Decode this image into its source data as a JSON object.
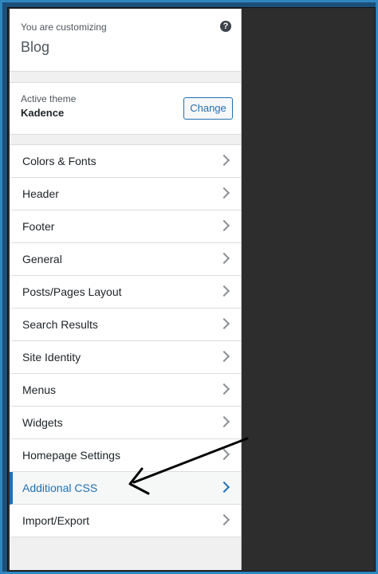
{
  "header": {
    "customizing_label": "You are customizing",
    "title": "Blog",
    "help_icon": "?"
  },
  "theme": {
    "label": "Active theme",
    "name": "Kadence",
    "change_label": "Change"
  },
  "menu": {
    "items": [
      {
        "label": "Colors & Fonts"
      },
      {
        "label": "Header"
      },
      {
        "label": "Footer"
      },
      {
        "label": "General"
      },
      {
        "label": "Posts/Pages Layout"
      },
      {
        "label": "Search Results"
      },
      {
        "label": "Site Identity"
      },
      {
        "label": "Menus"
      },
      {
        "label": "Widgets"
      },
      {
        "label": "Homepage Settings"
      },
      {
        "label": "Additional CSS",
        "active": true
      },
      {
        "label": "Import/Export"
      }
    ]
  },
  "colors": {
    "accent": "#2271b1",
    "frame": "#2f86bf",
    "preview_bg": "#2d2d2d"
  }
}
